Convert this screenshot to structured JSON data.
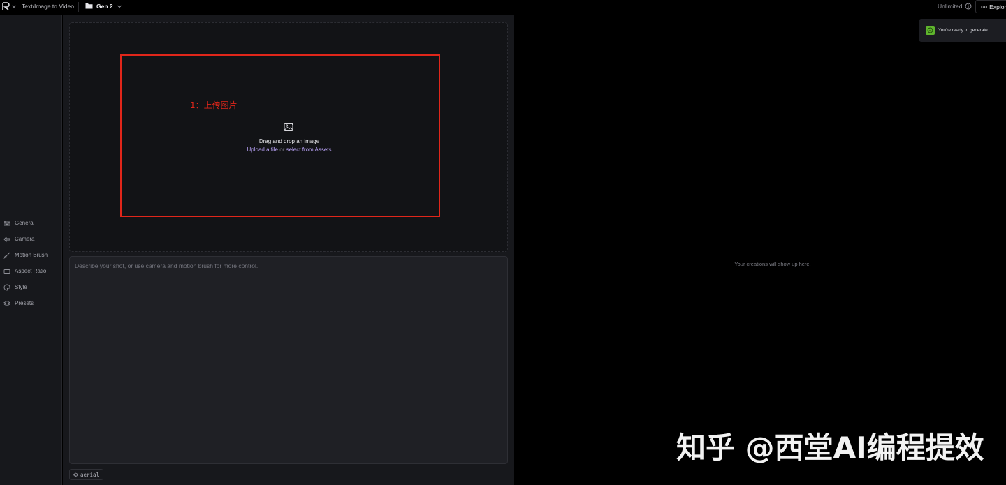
{
  "topbar": {
    "breadcrumb_title": "Text/Image to Video",
    "project_name": "Gen 2",
    "plan_label": "Unlimited",
    "explore_label": "Explore"
  },
  "sidebar": {
    "items": [
      {
        "label": "General",
        "icon": "sliders-icon"
      },
      {
        "label": "Camera",
        "icon": "camera-icon"
      },
      {
        "label": "Motion Brush",
        "icon": "brush-icon"
      },
      {
        "label": "Aspect Ratio",
        "icon": "aspect-ratio-icon"
      },
      {
        "label": "Style",
        "icon": "palette-icon"
      },
      {
        "label": "Presets",
        "icon": "layers-icon"
      }
    ]
  },
  "upload": {
    "annotation": "1：上传图片",
    "title": "Drag and drop an image",
    "upload_link": "Upload a file",
    "or_text": "or",
    "assets_link": "select from Assets"
  },
  "prompt": {
    "placeholder": "Describe your shot, or use camera and motion brush for more control.",
    "value": ""
  },
  "preset_chip": {
    "label": "aerial"
  },
  "results": {
    "empty_text": "Your creations will show up here."
  },
  "toast": {
    "text": "You're ready to generate."
  },
  "watermark": {
    "text": "知乎 @西堂AI编程提效"
  },
  "colors": {
    "annotation_red": "#e0261a",
    "link_purple": "#b7a1f5",
    "success_green": "#5fb52d"
  }
}
